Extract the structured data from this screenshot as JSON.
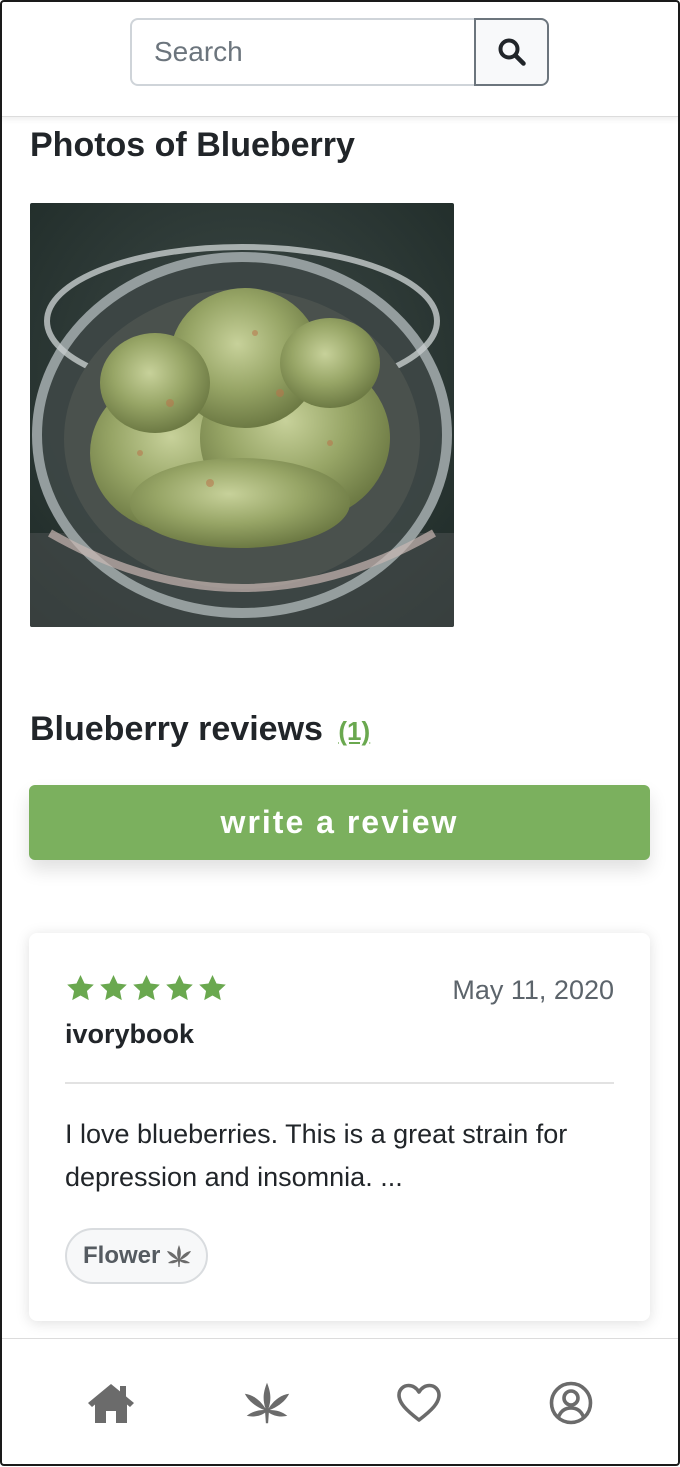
{
  "search": {
    "placeholder": "Search"
  },
  "photos": {
    "title": "Photos of Blueberry"
  },
  "reviews": {
    "title": "Blueberry reviews",
    "count": "(1)",
    "write_button": "write a review",
    "items": [
      {
        "rating": 5,
        "date": "May 11, 2020",
        "author": "ivorybook",
        "text": "I love blueberries. This is a great strain for depression and insomnia. ...",
        "tag": "Flower"
      }
    ]
  },
  "colors": {
    "accent": "#7bb05e",
    "star": "#6aa84f",
    "icon": "#6b6b6b"
  },
  "nav": {
    "items": [
      "home-icon",
      "cannabis-leaf-icon",
      "heart-icon",
      "user-circle-icon"
    ]
  }
}
